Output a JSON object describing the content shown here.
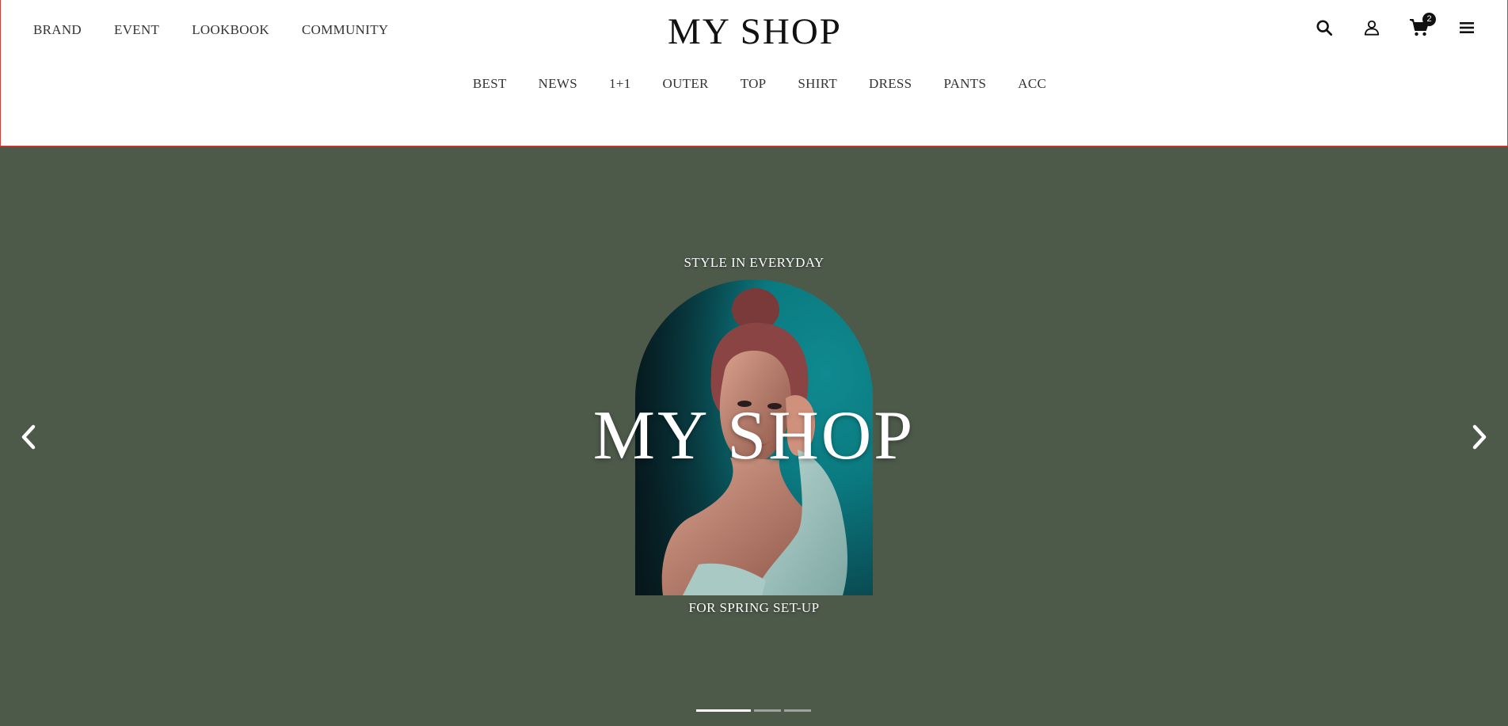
{
  "header": {
    "logo": "MY SHOP",
    "top_nav": [
      "BRAND",
      "EVENT",
      "LOOKBOOK",
      "COMMUNITY"
    ],
    "category_nav": [
      "BEST",
      "NEWS",
      "1+1",
      "OUTER",
      "TOP",
      "SHIRT",
      "DRESS",
      "PANTS",
      "ACC"
    ],
    "icons": {
      "search": "search-icon",
      "account": "user-icon",
      "cart": "cart-icon",
      "menu": "hamburger-menu-icon"
    },
    "cart_count": "2"
  },
  "hero": {
    "eyebrow": "STYLE IN EVERYDAY",
    "title": "MY SHOP",
    "subtitle": "FOR SPRING SET-UP",
    "background_color": "#4d5a4a",
    "slides_total": 3,
    "active_slide": 1
  },
  "colors": {
    "header_border": "#d43b3b",
    "hero_bg": "#4d5a4a",
    "image_teal": "#0a7a80"
  }
}
